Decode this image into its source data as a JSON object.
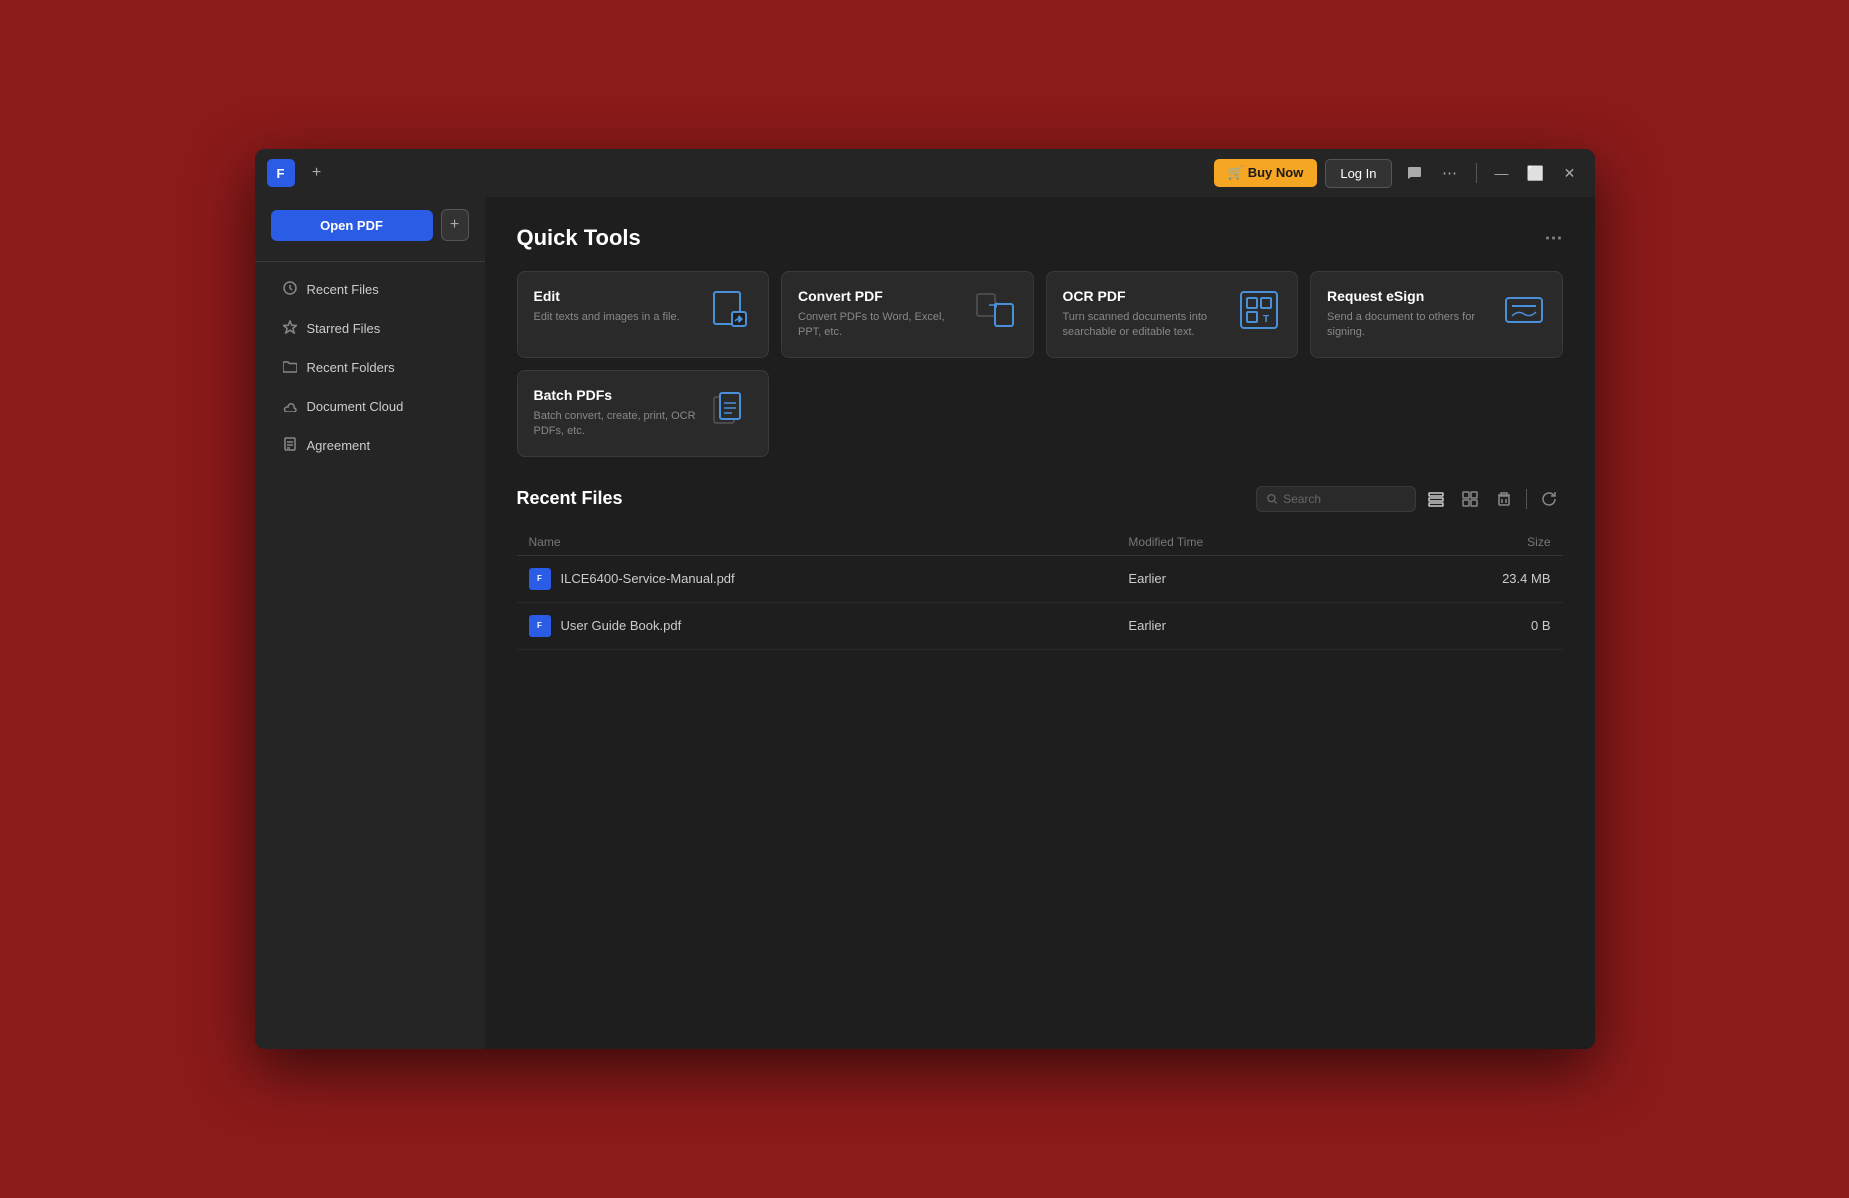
{
  "titleBar": {
    "logo": "F",
    "newTabLabel": "+",
    "buyNowLabel": "🛒 Buy Now",
    "loginLabel": "Log In",
    "chatIconLabel": "💬",
    "moreIconLabel": "⋯",
    "minimizeLabel": "—",
    "maximizeLabel": "⬜",
    "closeLabel": "✕"
  },
  "sidebar": {
    "openPdfLabel": "Open PDF",
    "newPlusLabel": "+",
    "navItems": [
      {
        "id": "recent-files",
        "icon": "🕐",
        "label": "Recent Files"
      },
      {
        "id": "starred-files",
        "icon": "☆",
        "label": "Starred Files"
      },
      {
        "id": "recent-folders",
        "icon": "🗂",
        "label": "Recent Folders"
      },
      {
        "id": "document-cloud",
        "icon": "☁",
        "label": "Document Cloud"
      },
      {
        "id": "agreement",
        "icon": "📄",
        "label": "Agreement"
      }
    ]
  },
  "quickTools": {
    "sectionTitle": "Quick Tools",
    "moreLabel": "⋯",
    "tools": [
      {
        "id": "edit",
        "title": "Edit",
        "description": "Edit texts and images in a file.",
        "iconType": "edit"
      },
      {
        "id": "convert-pdf",
        "title": "Convert PDF",
        "description": "Convert PDFs to Word, Excel, PPT, etc.",
        "iconType": "convert"
      },
      {
        "id": "ocr-pdf",
        "title": "OCR PDF",
        "description": "Turn scanned documents into searchable or editable text.",
        "iconType": "ocr"
      },
      {
        "id": "request-esign",
        "title": "Request eSign",
        "description": "Send a document to others for signing.",
        "iconType": "esign"
      },
      {
        "id": "batch-pdfs",
        "title": "Batch PDFs",
        "description": "Batch convert, create, print, OCR PDFs, etc.",
        "iconType": "batch"
      }
    ]
  },
  "recentFiles": {
    "sectionTitle": "Recent Files",
    "search": {
      "placeholder": "Search"
    },
    "columns": {
      "name": "Name",
      "modifiedTime": "Modified Time",
      "size": "Size"
    },
    "files": [
      {
        "id": "file-1",
        "name": "ILCE6400-Service-Manual.pdf",
        "modifiedTime": "Earlier",
        "size": "23.4 MB"
      },
      {
        "id": "file-2",
        "name": "User Guide Book.pdf",
        "modifiedTime": "Earlier",
        "size": "0 B"
      }
    ]
  },
  "colors": {
    "accent": "#2B5CE6",
    "buyNow": "#F5A623",
    "bg": "#1e1e1e",
    "sidebar": "#252525"
  }
}
